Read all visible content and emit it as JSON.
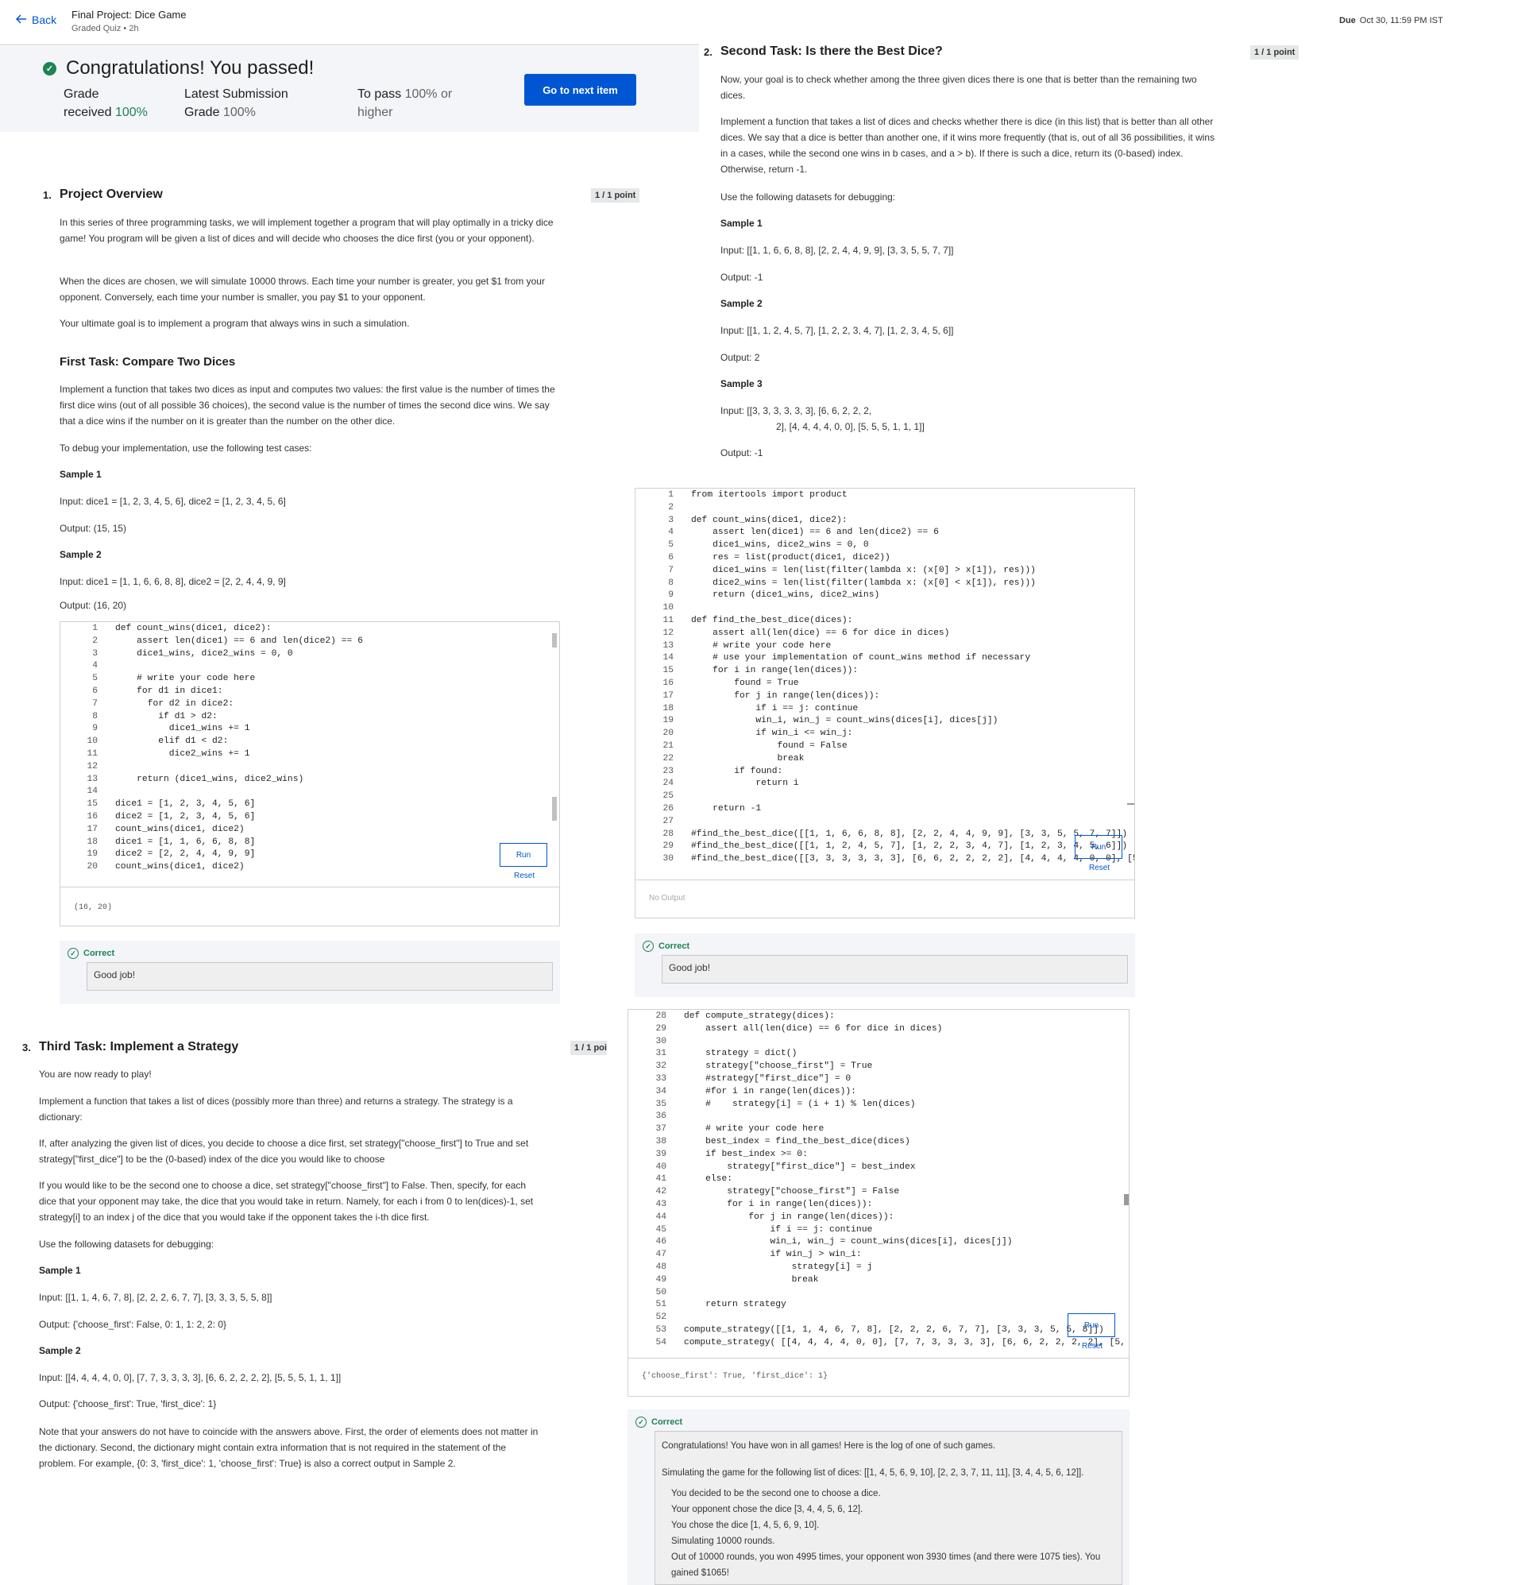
{
  "header": {
    "back": "Back",
    "course_title": "Final Project: Dice Game",
    "course_sub": "Graded Quiz • 2h",
    "due_label": "Due",
    "due_value": "Oct 30, 11:59 PM IST"
  },
  "banner": {
    "congrats": "Congratulations! You passed!",
    "grade_label_1": "Grade",
    "grade_label_2": "received",
    "grade_value": "100%",
    "latest_label_1": "Latest Submission",
    "latest_label_2": "Grade",
    "latest_value": "100%",
    "pass_label_1": "To pass",
    "pass_value_1": "100% or",
    "pass_value_2": "higher",
    "next_button": "Go to next item"
  },
  "q1": {
    "number": "1.",
    "title": "Project Overview",
    "points": "1 / 1 point",
    "p1": "In this series of three programming tasks, we will implement together a program that will play optimally in a tricky dice game! You program will be given a list of dices and will decide who chooses the dice first (you or your opponent).",
    "p2": "When the dices are chosen, we will simulate 10000 throws. Each time your number is greater, you get $1 from your opponent. Conversely, each time your number is smaller, you pay $1 to your opponent.",
    "p3": "Your ultimate goal is to implement a program that always wins in such a simulation.",
    "subtitle": "First Task: Compare Two Dices",
    "p4": "Implement a function that takes two dices as input and computes two values: the first value is the number of times the first dice wins (out of all possible 36 choices), the second value is the number of times the second dice wins. We say that a dice wins if the number on it is greater than the number on the other dice.",
    "p5": "To debug your implementation, use the following test cases:",
    "sample1_title": "Sample 1",
    "sample1_input": "Input: dice1 = [1, 2, 3, 4, 5, 6], dice2 = [1, 2, 3, 4, 5, 6]",
    "sample1_output": "Output: (15, 15)",
    "sample2_title": "Sample 2",
    "sample2_input": "Input: dice1 = [1, 1, 6, 6, 8, 8], dice2 = [2, 2, 4, 4, 9, 9]",
    "sample2_output": "Output: (16, 20)",
    "line_numbers": "1\n2\n3\n4\n5\n6\n7\n8\n9\n10\n11\n12\n13\n14\n15\n16\n17\n18\n19\n20",
    "code": "def count_wins(dice1, dice2):\n    assert len(dice1) == 6 and len(dice2) == 6\n    dice1_wins, dice2_wins = 0, 0\n\n    # write your code here\n    for d1 in dice1:\n      for d2 in dice2:\n        if d1 > d2:\n          dice1_wins += 1\n        elif d1 < d2:\n          dice2_wins += 1\n\n    return (dice1_wins, dice2_wins)\n\ndice1 = [1, 2, 3, 4, 5, 6]\ndice2 = [1, 2, 3, 4, 5, 6]\ncount_wins(dice1, dice2)\ndice1 = [1, 1, 6, 6, 8, 8]\ndice2 = [2, 2, 4, 4, 9, 9]\ncount_wins(dice1, dice2)",
    "run": "Run",
    "reset": "Reset",
    "output": "(16, 20)",
    "correct": "Correct",
    "feedback": "Good job!"
  },
  "q2": {
    "number": "2.",
    "title": "Second Task: Is there the Best Dice?",
    "points": "1 / 1 point",
    "p1": "Now, your goal is to check whether among the three given dices there is one that is better than the remaining two dices.",
    "p2": "Implement a function that takes a list of dices and checks whether there is dice (in this list) that is better than all other dices. We say that a dice is better than another one, if it wins more frequently (that is, out of all 36 possibilities, it wins in a cases, while the second one wins in b cases, and a > b). If there is such a dice, return its (0-based) index. Otherwise, return -1.",
    "p3": "Use the following datasets for debugging:",
    "sample1_title": "Sample 1",
    "sample1_input": "Input: [[1, 1, 6, 6, 8, 8], [2, 2, 4, 4, 9, 9], [3, 3, 5, 5, 7, 7]]",
    "sample1_output": "Output: -1",
    "sample2_title": "Sample 2",
    "sample2_input": "Input: [[1, 1, 2, 4, 5, 7], [1, 2, 2, 3, 4, 7], [1, 2, 3, 4, 5, 6]]",
    "sample2_output": "Output: 2",
    "sample3_title": "Sample 3",
    "sample3_input_1": "Input: [[3, 3, 3, 3, 3, 3], [6, 6, 2, 2, 2,",
    "sample3_input_2": "2], [4, 4, 4, 4, 0, 0], [5, 5, 5, 1, 1, 1]]",
    "sample3_output": "Output: -1",
    "line_numbers": "1\n2\n3\n4\n5\n6\n7\n8\n9\n10\n11\n12\n13\n14\n15\n16\n17\n18\n19\n20\n21\n22\n23\n24\n25\n26\n27\n28\n29\n30",
    "code": "from itertools import product\n\ndef count_wins(dice1, dice2):\n    assert len(dice1) == 6 and len(dice2) == 6\n    dice1_wins, dice2_wins = 0, 0\n    res = list(product(dice1, dice2))\n    dice1_wins = len(list(filter(lambda x: (x[0] > x[1]), res)))\n    dice2_wins = len(list(filter(lambda x: (x[0] < x[1]), res)))\n    return (dice1_wins, dice2_wins)\n\ndef find_the_best_dice(dices):\n    assert all(len(dice) == 6 for dice in dices)\n    # write your code here\n    # use your implementation of count_wins method if necessary\n    for i in range(len(dices)):\n        found = True\n        for j in range(len(dices)):\n            if i == j: continue\n            win_i, win_j = count_wins(dices[i], dices[j])\n            if win_i <= win_j:\n                found = False\n                break\n        if found:\n            return i\n\n    return -1\n\n#find_the_best_dice([[1, 1, 6, 6, 8, 8], [2, 2, 4, 4, 9, 9], [3, 3, 5, 5, 7, 7]])\n#find_the_best_dice([[1, 1, 2, 4, 5, 7], [1, 2, 2, 3, 4, 7], [1, 2, 3, 4, 5, 6]])\n#find_the_best_dice([[3, 3, 3, 3, 3, 3], [6, 6, 2, 2, 2, 2], [4, 4, 4, 4, 0, 0], [5, 5,",
    "run": "Run",
    "reset": "Reset",
    "output": "No Output",
    "correct": "Correct",
    "feedback": "Good job!"
  },
  "q3": {
    "number": "3.",
    "title": "Third Task: Implement a Strategy",
    "points": "1 / 1 poi",
    "p0": "You are now ready to play!",
    "p1": "Implement a function that takes a list of dices (possibly more than three) and returns a strategy. The strategy is a dictionary:",
    "p2": "If, after analyzing the given list of dices, you decide to choose a dice first, set strategy[\"choose_first\"] to True and set strategy[\"first_dice\"] to be the (0-based) index of the dice you would like to choose",
    "p3": "If you would like to be the second one to choose a dice, set strategy[\"choose_first\"] to False. Then, specify, for each dice that your opponent may take, the dice that you would take in return. Namely, for each i from 0 to len(dices)-1, set strategy[i] to an index j of the dice that you would take if the opponent takes the i-th dice first.",
    "p4": "Use the following datasets for debugging:",
    "sample1_title": "Sample 1",
    "sample1_input": "Input: [[1, 1, 4, 6, 7, 8], [2, 2, 2, 6, 7, 7], [3, 3, 3, 5, 5, 8]]",
    "sample1_output": "Output: {'choose_first': False, 0: 1, 1: 2, 2: 0}",
    "sample2_title": "Sample 2",
    "sample2_input": "Input: [[4, 4, 4, 4, 0, 0], [7, 7, 3, 3, 3, 3], [6, 6, 2, 2, 2, 2], [5, 5, 5, 1, 1, 1]]",
    "sample2_output": "Output: {'choose_first': True, 'first_dice': 1}",
    "p5": "Note that your answers do not have to coincide with the answers above. First, the order of elements does not matter in the dictionary. Second, the dictionary might contain extra information that is not required in the statement of the problem. For example, {0: 3, 'first_dice': 1, 'choose_first': True} is also a correct output in Sample 2.",
    "line_numbers": "28\n29\n30\n31\n32\n33\n34\n35\n36\n37\n38\n39\n40\n41\n42\n43\n44\n45\n46\n47\n48\n49\n50\n51\n52\n53\n54",
    "code": "def compute_strategy(dices):\n    assert all(len(dice) == 6 for dice in dices)\n\n    strategy = dict()\n    strategy[\"choose_first\"] = True\n    #strategy[\"first_dice\"] = 0\n    #for i in range(len(dices)):\n    #    strategy[i] = (i + 1) % len(dices)\n\n    # write your code here\n    best_index = find_the_best_dice(dices)\n    if best_index >= 0:\n        strategy[\"first_dice\"] = best_index\n    else:\n        strategy[\"choose_first\"] = False\n        for i in range(len(dices)):\n            for j in range(len(dices)):\n                if i == j: continue\n                win_i, win_j = count_wins(dices[i], dices[j])\n                if win_j > win_i:\n                    strategy[i] = j\n                    break\n\n    return strategy\n\ncompute_strategy([[1, 1, 4, 6, 7, 8], [2, 2, 2, 6, 7, 7], [3, 3, 3, 5, 5, 8]])\ncompute_strategy( [[4, 4, 4, 4, 0, 0], [7, 7, 3, 3, 3, 3], [6, 6, 2, 2, 2, 2], [5, 5, 5",
    "run": "Run",
    "reset": "Reset",
    "output": "{'choose_first': True, 'first_dice': 1}",
    "correct": "Correct",
    "log_1": "Congratulations! You have won in all games! Here is the log of one of such games.",
    "log_2": "Simulating the game for the following list of dices: [[1, 4, 5, 6, 9, 10], [2, 2, 3, 7, 11, 11], [3, 4, 4, 5, 6, 12]].",
    "log_3": "You decided to be the second one to choose a dice.",
    "log_4": "Your opponent chose the dice [3, 4, 4, 5, 6, 12].",
    "log_5": "You chose the dice [1, 4, 5, 6, 9, 10].",
    "log_6": "Simulating 10000 rounds.",
    "log_7": "Out of 10000 rounds, you won 4995 times, your opponent won 3930 times (and there were 1075 ties). You gained $1065!"
  },
  "colors": {
    "accent": "#0056d2",
    "success": "#1f8354"
  },
  "icons": [
    "arrow-left-icon",
    "check-circle-icon"
  ]
}
